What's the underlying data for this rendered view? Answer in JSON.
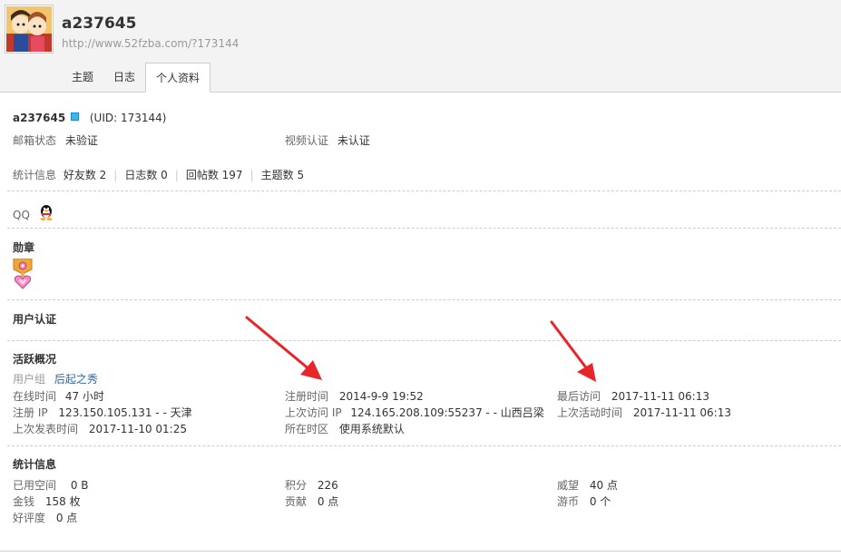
{
  "profile": {
    "username": "a237645",
    "url": "http://www.52fzba.com/?173144",
    "uid": "(UID: 173144)",
    "tabs": [
      "主题",
      "日志",
      "个人资料"
    ]
  },
  "basic": {
    "email_label": "邮箱状态",
    "email_value": "未验证",
    "video_label": "视频认证",
    "video_value": "未认证"
  },
  "stats_line": {
    "label": "统计信息",
    "friends": "好友数 2",
    "logs": "日志数 0",
    "replies": "回帖数 197",
    "topics": "主题数 5"
  },
  "qq": {
    "label": "QQ"
  },
  "medals": {
    "title": "勋章"
  },
  "auth": {
    "title": "用户认证"
  },
  "activity": {
    "title": "活跃概况",
    "group_label": "用户组",
    "group_value": "后起之秀",
    "online_label": "在线时间",
    "online_value": "47 小时",
    "reg_ip_label": "注册 IP",
    "reg_ip_value": "123.150.105.131 - - 天津",
    "last_post_label": "上次发表时间",
    "last_post_value": "2017-11-10 01:25",
    "reg_time_label": "注册时间",
    "reg_time_value": "2014-9-9 19:52",
    "last_ip_label": "上次访问 IP",
    "last_ip_value": "124.165.208.109:55237 - - 山西吕梁",
    "tz_label": "所在时区",
    "tz_value": "使用系统默认",
    "last_visit_label": "最后访问",
    "last_visit_value": "2017-11-11 06:13",
    "last_active_label": "上次活动时间",
    "last_active_value": "2017-11-11 06:13"
  },
  "statistics": {
    "title": "统计信息",
    "space_label": "已用空间",
    "space_value": "0 B",
    "money_label": "金钱",
    "money_value": "158 枚",
    "rating_label": "好评度",
    "rating_value": "0 点",
    "points_label": "积分",
    "points_value": "226",
    "contrib_label": "贡献",
    "contrib_value": "0 点",
    "prestige_label": "威望",
    "prestige_value": "40 点",
    "coins_label": "游币",
    "coins_value": "0 个"
  },
  "colors": {
    "link": "#336699",
    "annotation_arrow": "#e8262a",
    "header_bg": "#f3f3f3"
  }
}
